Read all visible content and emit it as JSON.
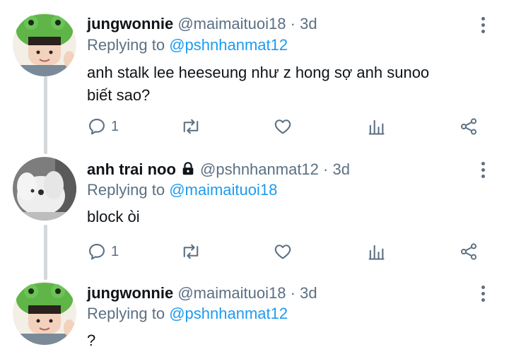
{
  "tweets": [
    {
      "name": "jungwonnie",
      "handle": "@maimaituoi18",
      "separator": "·",
      "time": "3d",
      "replying_prefix": "Replying to",
      "replying_to": "@pshnhanmat12",
      "text_line1": "anh stalk lee heeseung như z hong sợ anh sunoo",
      "text_line2": "biết sao?",
      "reply_count": "1",
      "avatar_icon": "frog-hat-avatar"
    },
    {
      "name": "anh trai noo",
      "handle": "@pshnhanmat12",
      "separator": "·",
      "time": "3d",
      "replying_prefix": "Replying to",
      "replying_to": "@maimaituoi18",
      "text_line1": "block òi",
      "reply_count": "1",
      "protected": true,
      "avatar_icon": "white-dog-avatar"
    },
    {
      "name": "jungwonnie",
      "handle": "@maimaituoi18",
      "separator": "·",
      "time": "3d",
      "replying_prefix": "Replying to",
      "replying_to": "@pshnhanmat12",
      "text_line1": "?",
      "avatar_icon": "frog-hat-avatar"
    }
  ],
  "colors": {
    "link": "#1d9bf0",
    "muted": "#5b7083",
    "text": "#0f1419",
    "thread_line": "#d4d8db"
  }
}
